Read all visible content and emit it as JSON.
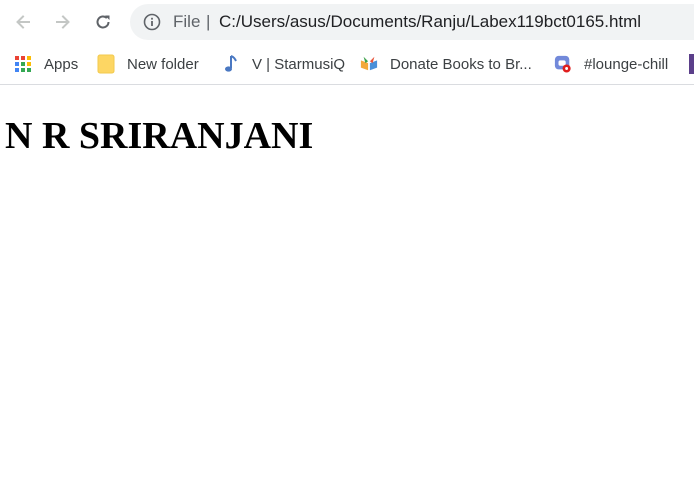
{
  "browser": {
    "back_icon": "arrow-left-icon",
    "forward_icon": "arrow-right-icon",
    "reload_icon": "reload-icon",
    "address_bar": {
      "info_icon": "info-circle-icon",
      "scheme_label": "File",
      "separator": "|",
      "url": "C:/Users/asus/Documents/Ranju/Labex119bct0165.html"
    }
  },
  "bookmarks": {
    "items": [
      {
        "label": "Apps",
        "icon": "apps-grid-icon"
      },
      {
        "label": "New folder",
        "icon": "folder-icon"
      },
      {
        "label": "V | StarmusiQ",
        "icon": "music-note-icon"
      },
      {
        "label": "Donate Books to Br...",
        "icon": "books-icon"
      },
      {
        "label": "#lounge-chill",
        "icon": "discord-icon"
      }
    ]
  },
  "page": {
    "heading": "N R SRIRANJANI"
  },
  "colors": {
    "omnibox_bg": "#f1f3f4",
    "text_primary": "#202124",
    "text_secondary": "#5f6368"
  }
}
